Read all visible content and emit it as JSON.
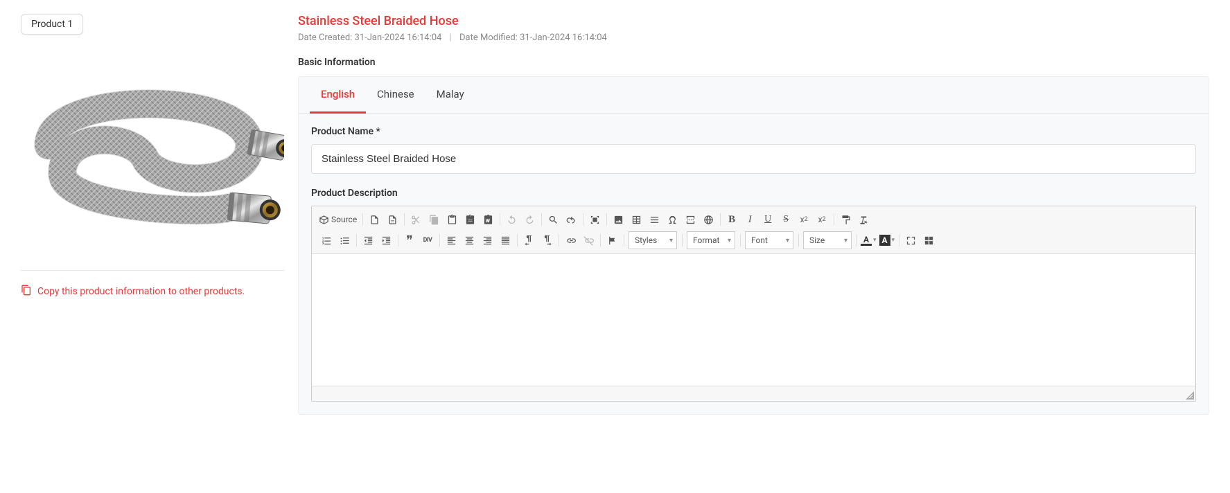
{
  "sidebar": {
    "product_tab_label": "Product 1",
    "copy_link_label": "Copy this product information to other products."
  },
  "header": {
    "title": "Stainless Steel Braided Hose",
    "date_created_label": "Date Created:",
    "date_created_value": "31-Jan-2024 16:14:04",
    "date_modified_label": "Date Modified:",
    "date_modified_value": "31-Jan-2024 16:14:04"
  },
  "section": {
    "basic_info": "Basic Information"
  },
  "tabs": {
    "english": "English",
    "chinese": "Chinese",
    "malay": "Malay"
  },
  "form": {
    "product_name_label": "Product Name *",
    "product_name_value": "Stainless Steel Braided Hose",
    "product_description_label": "Product Description"
  },
  "editor": {
    "source_label": "Source",
    "styles": "Styles",
    "format": "Format",
    "font": "Font",
    "size": "Size",
    "text_color_letter": "A",
    "bg_color_letter": "A",
    "bold": "B",
    "italic": "I",
    "underline": "U",
    "strike": "S",
    "div_label": "DIV",
    "quote_char": "❞"
  }
}
